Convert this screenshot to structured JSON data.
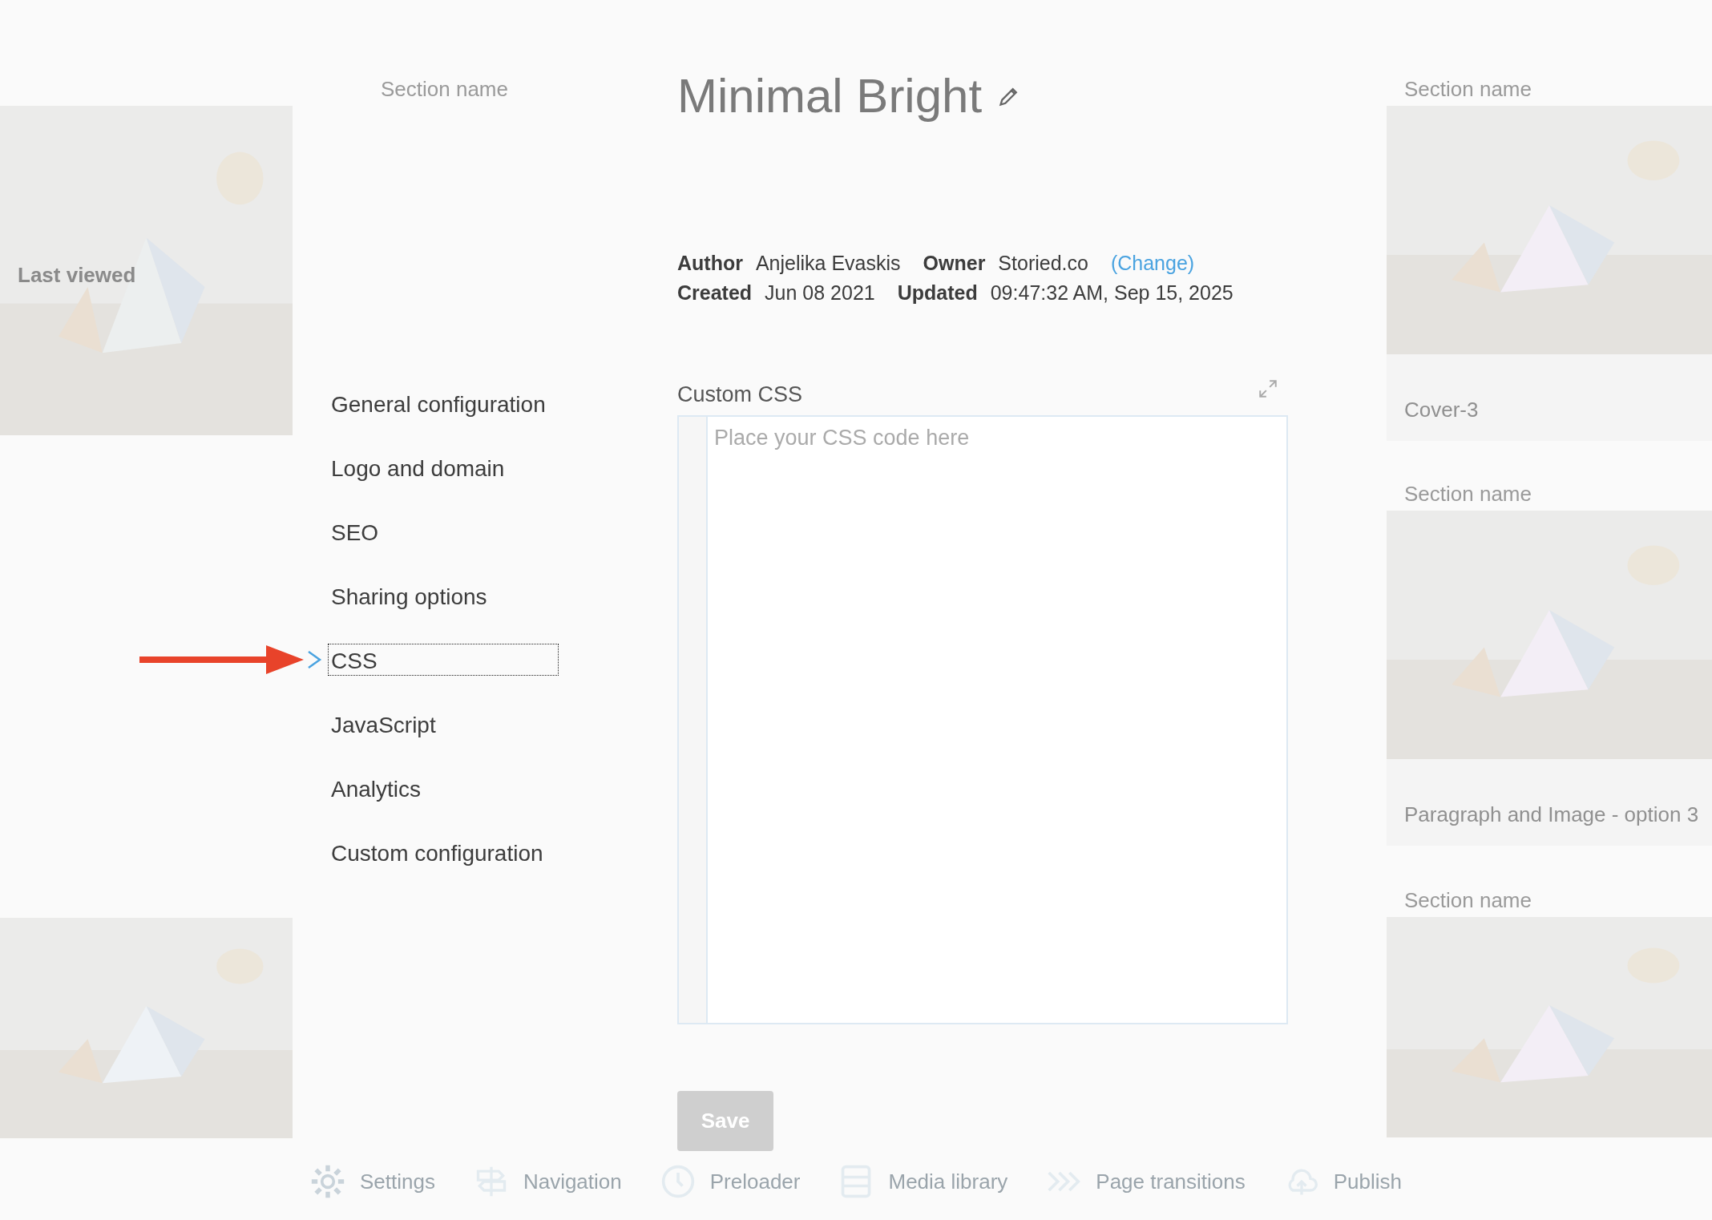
{
  "title": "Minimal Bright",
  "meta": [
    [
      {
        "label": "Author",
        "value": "Anjelika Evaskis"
      },
      {
        "label": "Owner",
        "value": "Storied.co",
        "link": "(Change)"
      }
    ],
    [
      {
        "label": "Created",
        "value": "Jun 08 2021"
      },
      {
        "label": "Updated",
        "value": "09:47:32 AM, Sep 15, 2025"
      }
    ]
  ],
  "nav": [
    {
      "label": "General configuration",
      "selected": false
    },
    {
      "label": "Logo and domain",
      "selected": false
    },
    {
      "label": "SEO",
      "selected": false
    },
    {
      "label": "Sharing options",
      "selected": false
    },
    {
      "label": "CSS",
      "selected": true
    },
    {
      "label": "JavaScript",
      "selected": false
    },
    {
      "label": "Analytics",
      "selected": false
    },
    {
      "label": "Custom configuration",
      "selected": false
    }
  ],
  "editor": {
    "label": "Custom CSS",
    "placeholder": "Place your CSS code here"
  },
  "save_button": {
    "label": "Save",
    "disabled": true
  },
  "background": {
    "left_caption": "Last viewed",
    "middle_heading": "Section name",
    "right_column": [
      {
        "heading": "Section name",
        "caption": "Cover-3"
      },
      {
        "heading": "Section name",
        "caption": "Paragraph and Image - option 3"
      },
      {
        "heading": "Section name"
      }
    ]
  },
  "toolbar": [
    {
      "kind": "gear",
      "label": "Settings"
    },
    {
      "kind": "signpost",
      "label": "Navigation"
    },
    {
      "kind": "clock",
      "label": "Preloader"
    },
    {
      "kind": "library",
      "label": "Media library"
    },
    {
      "kind": "chevrons",
      "label": "Page transitions"
    },
    {
      "kind": "cloud",
      "label": "Publish"
    }
  ]
}
